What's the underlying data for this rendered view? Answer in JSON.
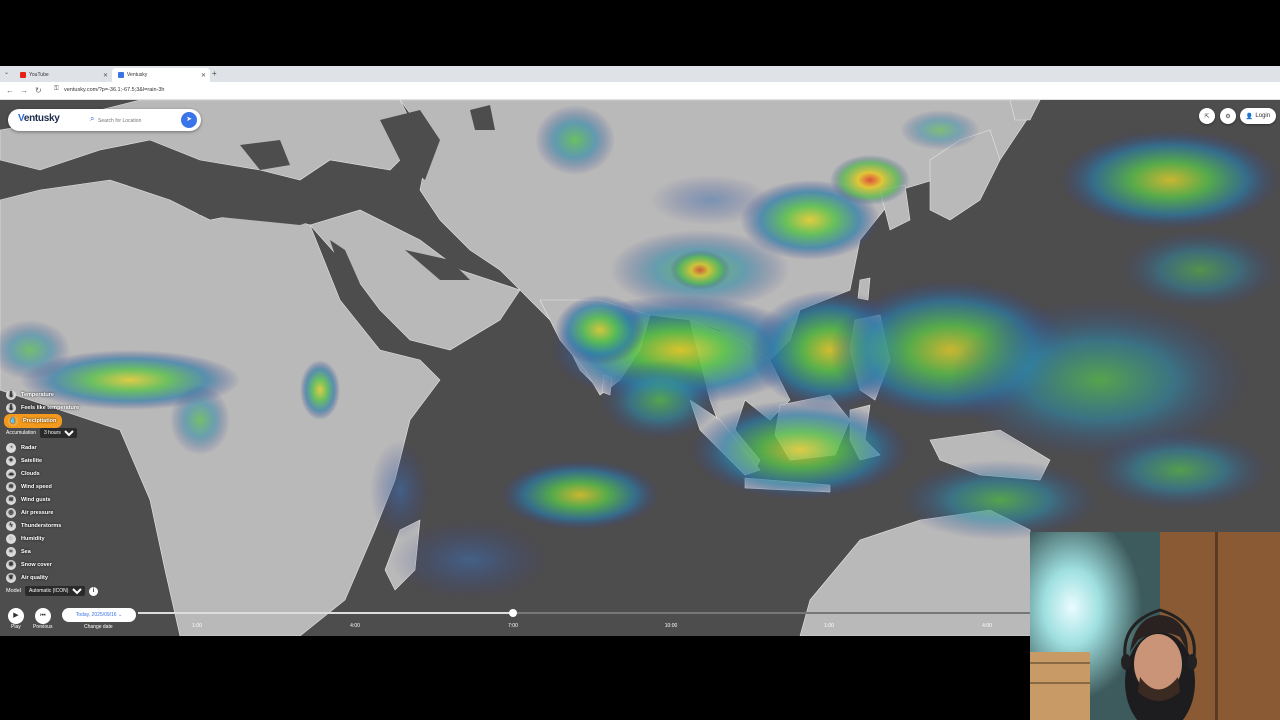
{
  "browser": {
    "tabs": [
      {
        "label": "YouTube",
        "active": false,
        "favicon_color": "#e62117"
      },
      {
        "label": "Ventusky",
        "active": true,
        "favicon_color": "#3b73e8"
      }
    ],
    "new_tab_label": "+",
    "url": "ventusky.com/?p=-36.1;-67.5;3&l=rain-3h"
  },
  "app": {
    "logo_prefix": "V",
    "logo_text": "entusky",
    "search_placeholder": "Search for Location",
    "top_controls": {
      "login_label": "Login"
    }
  },
  "layers": {
    "items": [
      {
        "label": "Temperature",
        "icon": "thermometer-icon",
        "glyph": "🌡",
        "active": false
      },
      {
        "label": "Feels like temperature",
        "icon": "thermometer-icon",
        "glyph": "🌡",
        "active": false
      },
      {
        "label": "Precipitation",
        "icon": "drop-icon",
        "glyph": "💧",
        "active": true
      }
    ],
    "accumulation_label": "Accumulation",
    "accumulation_value": "3 hours",
    "more_items": [
      {
        "label": "Radar",
        "icon": "radar-icon",
        "glyph": "◔"
      },
      {
        "label": "Satellite",
        "icon": "satellite-icon",
        "glyph": "✦"
      },
      {
        "label": "Clouds",
        "icon": "cloud-icon",
        "glyph": "☁"
      },
      {
        "label": "Wind speed",
        "icon": "wind-icon",
        "glyph": "≋"
      },
      {
        "label": "Wind gusts",
        "icon": "wind-icon",
        "glyph": "≋"
      },
      {
        "label": "Air pressure",
        "icon": "gauge-icon",
        "glyph": "◎"
      },
      {
        "label": "Thunderstorms",
        "icon": "lightning-icon",
        "glyph": "ϟ"
      },
      {
        "label": "Humidity",
        "icon": "humidity-icon",
        "glyph": "◌"
      },
      {
        "label": "Sea",
        "icon": "wave-icon",
        "glyph": "≈"
      },
      {
        "label": "Snow cover",
        "icon": "snowflake-icon",
        "glyph": "❄"
      },
      {
        "label": "Air quality",
        "icon": "leaf-icon",
        "glyph": "❦"
      }
    ],
    "model_label": "Model",
    "model_value": "Automatic (ICON)"
  },
  "timeline": {
    "play_label": "Play",
    "previous_label": "Previous",
    "date_value": "Today, 2025/09/16",
    "change_date_label": "Change date",
    "ticks": [
      "1:00",
      "4:00",
      "7:00",
      "10:00",
      "1:00",
      "4:00"
    ],
    "progress": 0.42
  },
  "colors": {
    "accent": "#3b73e8",
    "active_layer": "#f39a1e",
    "land": "#b9b9b9",
    "ocean": "#4d4d4d"
  }
}
